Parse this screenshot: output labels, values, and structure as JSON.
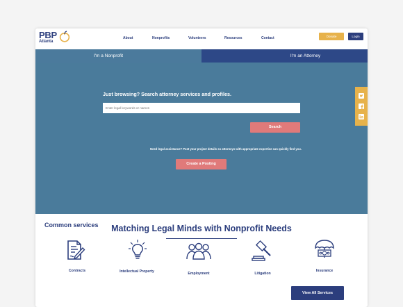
{
  "brand": {
    "name": "PBP",
    "city": "Atlanta"
  },
  "nav": [
    "About",
    "Nonprofits",
    "Volunteers",
    "Resources",
    "Contact"
  ],
  "header_buttons": {
    "donate": "Donate",
    "login": "Login"
  },
  "tabs": {
    "nonprofit": "I'm a Nonprofit",
    "attorney": "I'm an Attorney"
  },
  "hero": {
    "title": "Just browsing? Search attorney services and profiles.",
    "search_placeholder": "Enter legal keywords or names",
    "search_button": "Search",
    "help_text": "Need legal assistance? Post your project details so attorneys with appropriate expertise can quickly find you.",
    "post_button": "Create a Posting"
  },
  "social_icons": [
    "twitter-icon",
    "facebook-icon",
    "linkedin-icon"
  ],
  "main": {
    "title": "Matching Legal Minds with Nonprofit Needs",
    "common_services": "Common services",
    "services": [
      "Contracts",
      "Intellectual Property",
      "Employment",
      "Litigation",
      "Insurance"
    ],
    "view_all": "View All Services"
  },
  "colors": {
    "navy": "#2c3e7d",
    "hero_blue": "#4a7b9b",
    "tab_navy": "#2d4887",
    "coral": "#e07a7a",
    "gold": "#e7b24b"
  }
}
